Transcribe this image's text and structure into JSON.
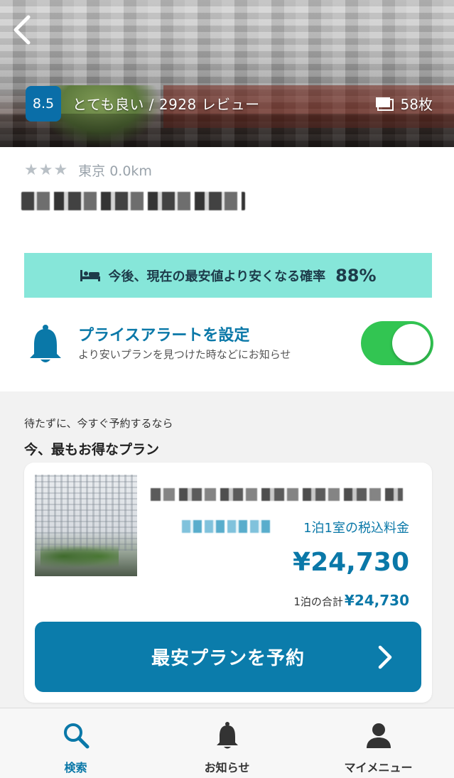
{
  "hero": {
    "score": "8.5",
    "review_text": "とても良い / 2928 レビュー",
    "photo_count": "58枚",
    "icons": {
      "back": "chevron-left-icon",
      "photos": "photos-icon"
    }
  },
  "hotel": {
    "stars": "★★★",
    "location": "東京 0.0km"
  },
  "price_prediction": {
    "text": "今後、現在の最安値より安くなる確率",
    "value": "88%",
    "icon": "bed-icon"
  },
  "price_alert": {
    "title": "プライスアラートを設定",
    "subtitle": "より安いプランを見つけた時などにお知らせ",
    "enabled": true,
    "toggle_color": "#32c552"
  },
  "best_plan": {
    "sub_label": "待たずに、今すぐ予約するなら",
    "title": "今、最もお得なプラン",
    "tax_label": "1泊1室の税込料金",
    "price": "¥24,730",
    "total_label": "1泊の合計",
    "total_value": "¥24,730",
    "button_label": "最安プランを予約"
  },
  "tabbar": {
    "items": [
      {
        "label": "検索",
        "icon": "search-icon",
        "active": true
      },
      {
        "label": "お知らせ",
        "icon": "bell-icon",
        "active": false
      },
      {
        "label": "マイメニュー",
        "icon": "user-icon",
        "active": false
      }
    ]
  },
  "colors": {
    "accent": "#0a78a8",
    "button": "#0b7cab",
    "banner": "#86e6d9",
    "badge": "#0a6ea8"
  }
}
